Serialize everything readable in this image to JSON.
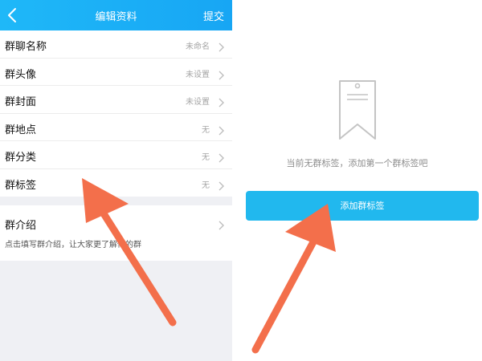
{
  "header": {
    "title": "编辑资料",
    "submit_label": "提交"
  },
  "rows": [
    {
      "label": "群聊名称",
      "value": "未命名"
    },
    {
      "label": "群头像",
      "value": "未设置"
    },
    {
      "label": "群封面",
      "value": "未设置"
    },
    {
      "label": "群地点",
      "value": "无"
    },
    {
      "label": "群分类",
      "value": "无"
    },
    {
      "label": "群标签",
      "value": "无"
    }
  ],
  "intro": {
    "label": "群介绍",
    "hint": "点击填写群介绍，让大家更了解你的群"
  },
  "tags_panel": {
    "empty_text": "当前无群标签，添加第一个群标签吧",
    "add_button_label": "添加群标签"
  },
  "colors": {
    "header_blue": "#1fb8f8",
    "button_blue": "#21b8ee",
    "arrow_orange": "#f36f4b"
  }
}
